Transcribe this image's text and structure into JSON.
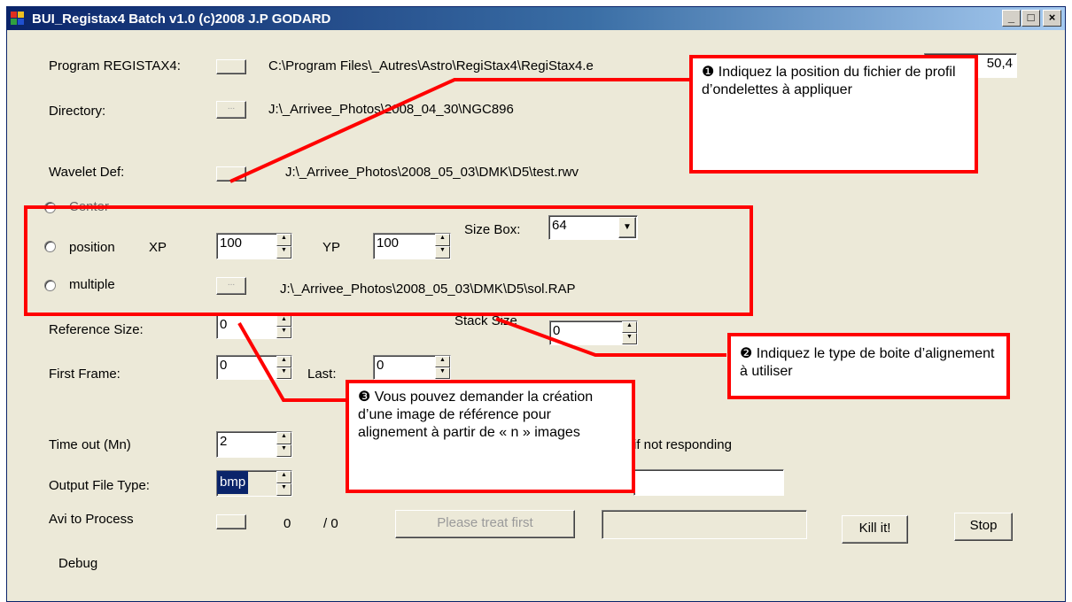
{
  "window": {
    "title": "BUI_Registax4  Batch v1.0 (c)2008 J.P GODARD",
    "controls": [
      "_",
      "□",
      "×"
    ]
  },
  "form": {
    "program_label": "Program REGISTAX4:",
    "program_path": "C:\\Program Files\\_Autres\\Astro\\RegiStax4\\RegiStax4.e",
    "version_value": "50,4",
    "directory_label": "Directory:",
    "directory_button": "...",
    "directory_path": "J:\\_Arrivee_Photos\\2008_04_30\\NGC896",
    "wavelet_label": "Wavelet Def:",
    "wavelet_path": "J:\\_Arrivee_Photos\\2008_05_03\\DMK\\D5\\test.rwv",
    "center_label": "Center",
    "position_label": "position",
    "xp_label": "XP",
    "xp_value": "100",
    "yp_label": "YP",
    "yp_value": "100",
    "sizebox_label": "Size Box:",
    "sizebox_value": "64",
    "multiple_label": "multiple",
    "multiple_button": "...",
    "multiple_path": "J:\\_Arrivee_Photos\\2008_05_03\\DMK\\D5\\sol.RAP",
    "refsize_label": "Reference Size:",
    "refsize_value": "0",
    "stacksize_label": "Stack Size",
    "stacksize_value": "0",
    "firstframe_label": "First Frame:",
    "firstframe_value": "0",
    "last_label": "Last:",
    "last_value": "0",
    "timeout_label": "Time out (Mn)",
    "timeout_value": "2",
    "notresponding_label": "if not responding",
    "output_label": "Output File Type:",
    "output_value": "bmp",
    "avi_label": "Avi to Process",
    "count_done": "0",
    "count_sep": "/ 0",
    "treat_button": "Please treat first",
    "kill_button": "Kill it!",
    "stop_button": "Stop",
    "debug_label": "Debug"
  },
  "callouts": {
    "c1_num": "❶",
    "c1_text": "Indiquez  la position du fichier de profil d’ondelettes à appliquer",
    "c2_num": "❷",
    "c2_text": "Indiquez  le type de boite d’alignement à utiliser",
    "c3_num": "❸",
    "c3_text": "Vous pouvez demander la création d’une image de référence pour alignement à partir de « n » images"
  },
  "colors": {
    "titlebar": "#0a246a",
    "annotation": "#ff0000",
    "face": "#ece9d8"
  }
}
